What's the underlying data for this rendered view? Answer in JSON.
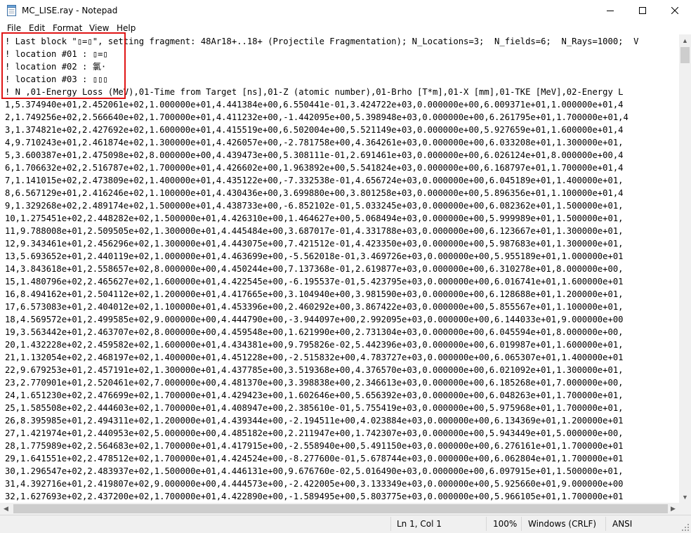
{
  "window": {
    "title": "MC_LISE.ray - Notepad",
    "icon": "notepad-icon",
    "controls": [
      "minimize-icon",
      "maximize-icon",
      "close-icon"
    ]
  },
  "menu": [
    "File",
    "Edit",
    "Format",
    "View",
    "Help"
  ],
  "editor": {
    "lines": [
      "! Last block \"▯=▯\", setting fragment: 48Ar18+..18+ (Projectile Fragmentation); N_Locations=3;  N_fields=6;  N_Rays=1000;  V",
      "! location #01 : ▯=▯",
      "! location #02 : 氯·",
      "! location #03 : ▯▯▯",
      "! N ,01-Energy Loss (MeV),01-Time from Target [ns],01-Z (atomic number),01-Brho [T*m],01-X [mm],01-TKE [MeV],02-Energy L",
      "1,5.374940e+01,2.452061e+02,1.000000e+01,4.441384e+00,6.550441e-01,3.424722e+03,0.000000e+00,6.009371e+01,1.000000e+01,4",
      "2,1.749256e+02,2.566640e+02,1.700000e+01,4.411232e+00,-1.442095e+00,5.398948e+03,0.000000e+00,6.261795e+01,1.700000e+01,4",
      "3,1.374821e+02,2.427692e+02,1.600000e+01,4.415519e+00,6.502004e+00,5.521149e+03,0.000000e+00,5.927659e+01,1.600000e+01,4",
      "4,9.710243e+01,2.461874e+02,1.300000e+01,4.426057e+00,-2.781758e+00,4.364261e+03,0.000000e+00,6.033208e+01,1.300000e+01,",
      "5,3.600387e+01,2.475098e+02,8.000000e+00,4.439473e+00,5.308111e-01,2.691461e+03,0.000000e+00,6.026124e+01,8.000000e+00,4",
      "6,1.706632e+02,2.516787e+02,1.700000e+01,4.426602e+00,1.963892e+00,5.541824e+03,0.000000e+00,6.168797e+01,1.700000e+01,4",
      "7,1.141015e+02,2.473809e+02,1.400000e+01,4.435122e+00,-7.332538e-01,4.656724e+03,0.000000e+00,6.045189e+01,1.400000e+01,",
      "8,6.567129e+01,2.416246e+02,1.100000e+01,4.430436e+00,3.699880e+00,3.801258e+03,0.000000e+00,5.896356e+01,1.100000e+01,4",
      "9,1.329268e+02,2.489174e+02,1.500000e+01,4.438733e+00,-6.852102e-01,5.033245e+03,0.000000e+00,6.082362e+01,1.500000e+01,",
      "10,1.275451e+02,2.448282e+02,1.500000e+01,4.426310e+00,1.464627e+00,5.068494e+03,0.000000e+00,5.999989e+01,1.500000e+01,",
      "11,9.788008e+01,2.509505e+02,1.300000e+01,4.445484e+00,3.687017e-01,4.331788e+03,0.000000e+00,6.123667e+01,1.300000e+01,",
      "12,9.343461e+01,2.456296e+02,1.300000e+01,4.443075e+00,7.421512e-01,4.423350e+03,0.000000e+00,5.987683e+01,1.300000e+01,",
      "13,5.693652e+01,2.440119e+02,1.000000e+01,4.463699e+00,-5.562018e-01,3.469726e+03,0.000000e+00,5.955189e+01,1.000000e+01",
      "14,3.843618e+01,2.558657e+02,8.000000e+00,4.450244e+00,7.137368e-01,2.619877e+03,0.000000e+00,6.310278e+01,8.000000e+00,",
      "15,1.480796e+02,2.465627e+02,1.600000e+01,4.422545e+00,-6.195537e-01,5.423795e+03,0.000000e+00,6.016741e+01,1.600000e+01",
      "16,8.494162e+01,2.504112e+02,1.200000e+01,4.417665e+00,3.104940e+00,3.981590e+03,0.000000e+00,6.128688e+01,1.200000e+01,",
      "17,6.573083e+01,2.404012e+02,1.100000e+01,4.453396e+00,2.460292e+00,3.867422e+03,0.000000e+00,5.855567e+01,1.100000e+01,",
      "18,4.569572e+01,2.499585e+02,9.000000e+00,4.444790e+00,-3.944097e+00,2.992095e+03,0.000000e+00,6.144033e+01,9.000000e+00",
      "19,3.563442e+01,2.463707e+02,8.000000e+00,4.459548e+00,1.621990e+00,2.731304e+03,0.000000e+00,6.045594e+01,8.000000e+00,",
      "20,1.432228e+02,2.459582e+02,1.600000e+01,4.434381e+00,9.795826e-02,5.442396e+03,0.000000e+00,6.019987e+01,1.600000e+01,",
      "21,1.132054e+02,2.468197e+02,1.400000e+01,4.451228e+00,-2.515832e+00,4.783727e+03,0.000000e+00,6.065307e+01,1.400000e+01",
      "22,9.679253e+01,2.457191e+02,1.300000e+01,4.437785e+00,3.519368e+00,4.376570e+03,0.000000e+00,6.021092e+01,1.300000e+01,",
      "23,2.770901e+01,2.520461e+02,7.000000e+00,4.481370e+00,3.398838e+00,2.346613e+03,0.000000e+00,6.185268e+01,7.000000e+00,",
      "24,1.651230e+02,2.476699e+02,1.700000e+01,4.429423e+00,1.602646e+00,5.656392e+03,0.000000e+00,6.048263e+01,1.700000e+01,",
      "25,1.585508e+02,2.444603e+02,1.700000e+01,4.408947e+00,2.385610e-01,5.755419e+03,0.000000e+00,5.975968e+01,1.700000e+01,",
      "26,8.395985e+01,2.494311e+02,1.200000e+01,4.439344e+00,-2.194511e+00,4.023884e+03,0.000000e+00,6.134369e+01,1.200000e+01",
      "27,1.421974e+01,2.440953e+02,5.000000e+00,4.485182e+00,2.211947e+00,1.742307e+03,0.000000e+00,5.943449e+01,5.000000e+00,",
      "28,1.775989e+02,2.564683e+02,1.700000e+01,4.417915e+00,-2.558940e+00,5.491150e+03,0.000000e+00,6.276161e+01,1.700000e+01",
      "29,1.641551e+02,2.478512e+02,1.700000e+01,4.424524e+00,-8.277600e-01,5.678744e+03,0.000000e+00,6.062804e+01,1.700000e+01",
      "30,1.296547e+02,2.483937e+02,1.500000e+01,4.446131e+00,9.676760e-02,5.016490e+03,0.000000e+00,6.097915e+01,1.500000e+01,",
      "31,4.392716e+01,2.419807e+02,9.000000e+00,4.444573e+00,-2.422005e+00,3.133349e+03,0.000000e+00,5.925660e+01,9.000000e+00",
      "32,1.627693e+02,2.437200e+02,1.700000e+01,4.422890e+00,-1.589495e+00,5.803775e+03,0.000000e+00,5.966105e+01,1.700000e+01"
    ]
  },
  "status": {
    "position": "Ln 1, Col 1",
    "zoom": "100%",
    "line_ending": "Windows (CRLF)",
    "encoding": "ANSI"
  },
  "annotation": {
    "color": "#e01515"
  }
}
